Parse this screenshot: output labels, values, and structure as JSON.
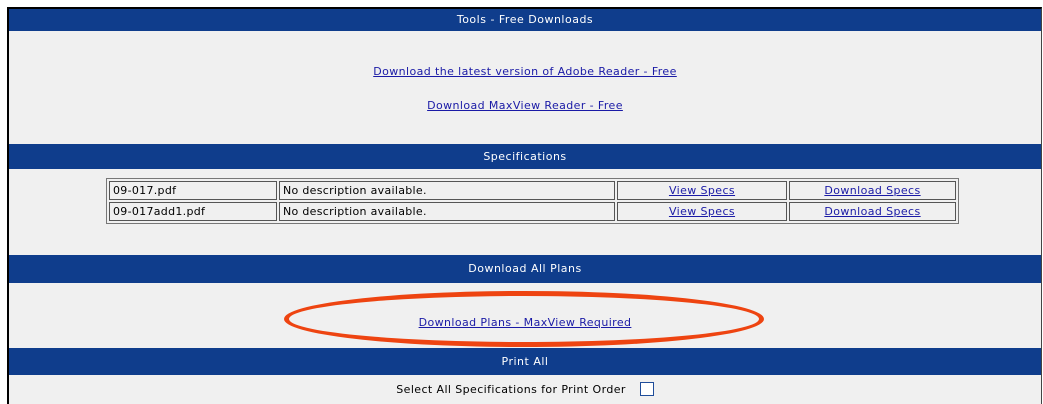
{
  "tools": {
    "header": "Tools - Free Downloads",
    "adobe_link": "Download the latest version of Adobe Reader - Free",
    "maxview_link": "Download MaxView Reader - Free"
  },
  "specifications": {
    "header": "Specifications",
    "rows": [
      {
        "file": "09-017.pdf",
        "description": "No description available.",
        "view": "View Specs",
        "download": "Download Specs"
      },
      {
        "file": "09-017add1.pdf",
        "description": "No description available.",
        "view": "View Specs",
        "download": "Download Specs"
      }
    ]
  },
  "plans": {
    "header": "Download All Plans",
    "link": "Download Plans - MaxView Required",
    "highlight_color": "#ee4411"
  },
  "print_all": {
    "header": "Print All",
    "select_label": "Select All Specifications for Print Order",
    "checked": false
  },
  "colors": {
    "header_bar": "#0f3d8c",
    "panel_bg": "#f0f0f0",
    "link": "#1a1aa6"
  }
}
